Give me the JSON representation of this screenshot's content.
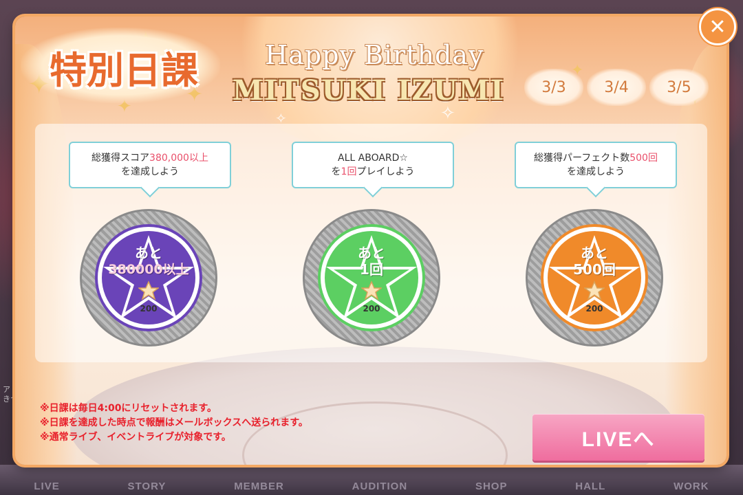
{
  "background": {
    "nav_items": [
      "LIVE",
      "STORY",
      "MEMBER",
      "AUDITION",
      "SHOP",
      "HALL",
      "WORK"
    ],
    "side_text": "ア\nきつ"
  },
  "dialog": {
    "title": "特別日課",
    "subtitle": "Happy Birthday",
    "name": "MITSUKI IZUMI",
    "dates": [
      "3/3",
      "3/4",
      "3/5"
    ],
    "close_icon": "close-icon"
  },
  "missions": [
    {
      "line1_pre": "総獲得スコア",
      "line1_hl": "380,000以上",
      "line1_post": "",
      "line2_pre": "を達成しよう",
      "line2_hl": "",
      "line2_post": "",
      "remain_label": "あと",
      "remain_value": "380000以上",
      "reward": "200",
      "color": "#6a44b8"
    },
    {
      "line1_pre": "ALL ABOARD☆",
      "line1_hl": "",
      "line1_post": "",
      "line2_pre": "を",
      "line2_hl": "1回",
      "line2_post": "プレイしよう",
      "remain_label": "あと",
      "remain_value": "1回",
      "reward": "200",
      "color": "#5ccf62"
    },
    {
      "line1_pre": "総獲得パーフェクト数",
      "line1_hl": "500回",
      "line1_post": "",
      "line2_pre": "を達成しよう",
      "line2_hl": "",
      "line2_post": "",
      "remain_label": "あと",
      "remain_value": "500回",
      "reward": "200",
      "color": "#f08a2a"
    }
  ],
  "notes": [
    "※日課は毎日4:00にリセットされます。",
    "※日課を達成した時点で報酬はメールボックスへ送られます。",
    "※通常ライブ、イベントライブが対象です。"
  ],
  "live_button": "LIVEへ",
  "colors": {
    "accent": "#f49442",
    "live_button": "#ef6d9e",
    "highlight": "#e94f6a",
    "notes": "#e8212c"
  }
}
